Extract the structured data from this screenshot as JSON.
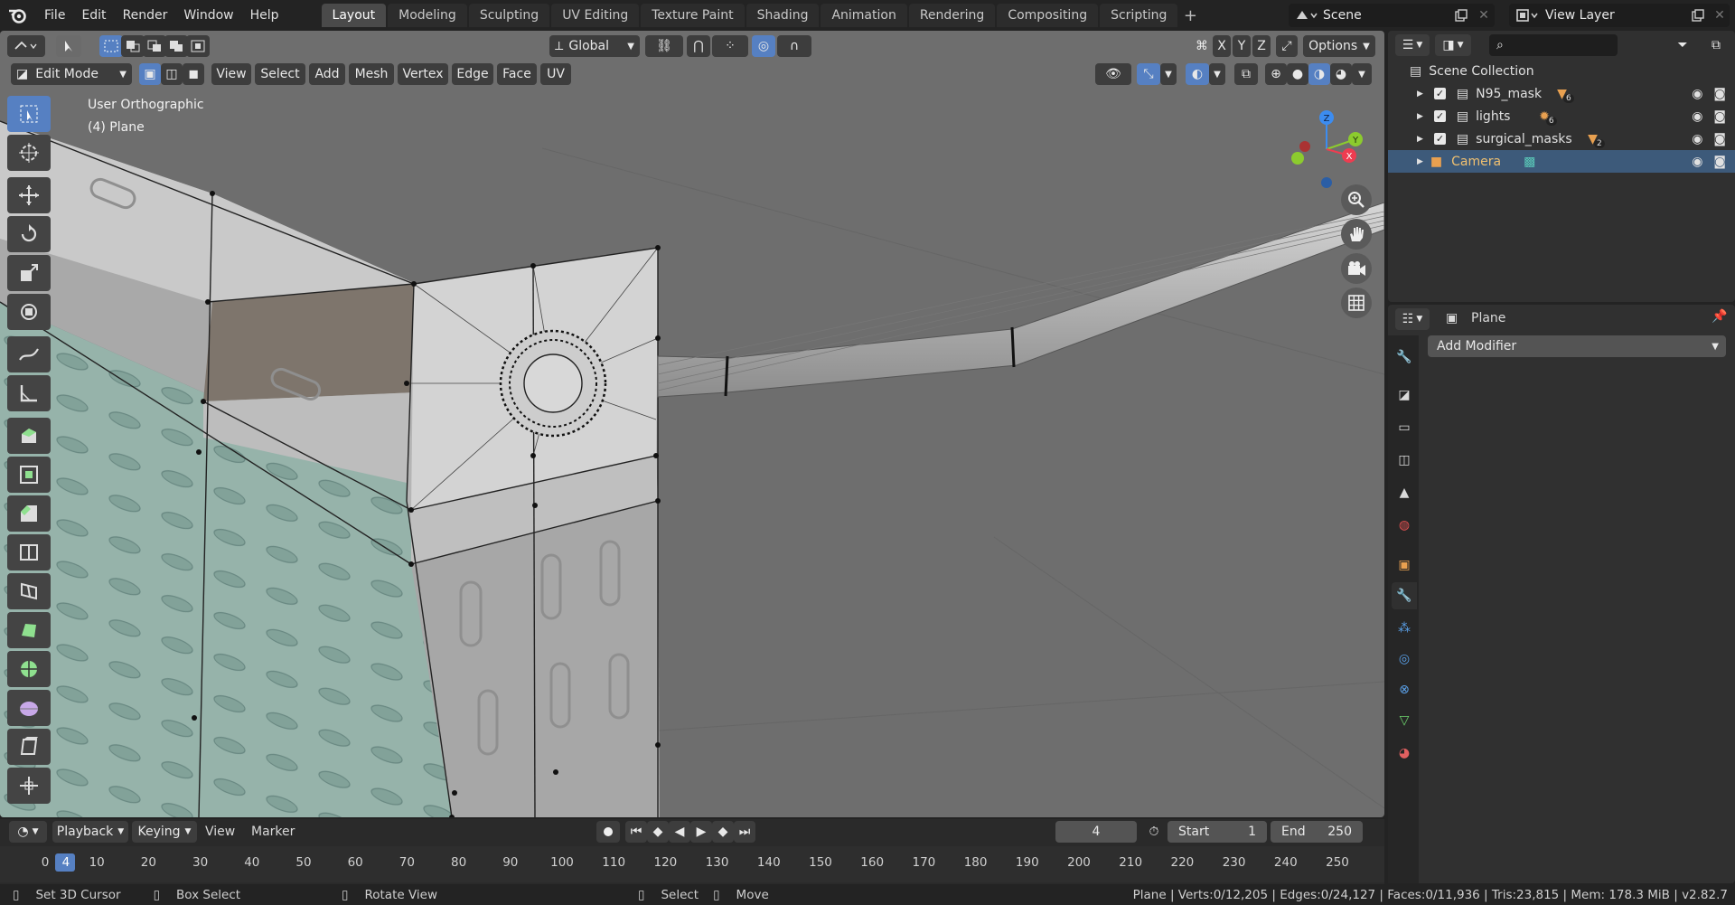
{
  "menu": [
    "File",
    "Edit",
    "Render",
    "Window",
    "Help"
  ],
  "workspaces": [
    {
      "label": "Layout",
      "active": true
    },
    {
      "label": "Modeling",
      "active": false
    },
    {
      "label": "Sculpting",
      "active": false
    },
    {
      "label": "UV Editing",
      "active": false
    },
    {
      "label": "Texture Paint",
      "active": false
    },
    {
      "label": "Shading",
      "active": false
    },
    {
      "label": "Animation",
      "active": false
    },
    {
      "label": "Rendering",
      "active": false
    },
    {
      "label": "Compositing",
      "active": false
    },
    {
      "label": "Scripting",
      "active": false
    }
  ],
  "scene": {
    "name": "Scene"
  },
  "view_layer": {
    "name": "View Layer"
  },
  "viewport_header": {
    "transform_orientation": "Global",
    "axes": [
      "X",
      "Y",
      "Z"
    ],
    "options_label": "Options",
    "mode": "Edit Mode",
    "menus": [
      "View",
      "Select",
      "Add",
      "Mesh",
      "Vertex",
      "Edge",
      "Face",
      "UV"
    ]
  },
  "viewport_overlay": {
    "view_name": "User Orthographic",
    "object_info": "(4) Plane"
  },
  "gizmo": {
    "x": "X",
    "y": "Y",
    "z": "Z"
  },
  "outliner": {
    "root": "Scene Collection",
    "items": [
      {
        "label": "N95_mask",
        "badge": "6",
        "selected": false
      },
      {
        "label": "lights",
        "badge": "6",
        "selected": false
      },
      {
        "label": "surgical_masks",
        "badge": "2",
        "selected": false
      },
      {
        "label": "Camera",
        "badge": "",
        "selected": true
      }
    ]
  },
  "properties": {
    "object_name": "Plane",
    "add_modifier_label": "Add Modifier"
  },
  "timeline": {
    "menus": [
      "Playback",
      "Keying",
      "View",
      "Marker"
    ],
    "current_frame": "4",
    "start_label": "Start",
    "start_value": "1",
    "end_label": "End",
    "end_value": "250",
    "ticks": [
      "0",
      "4",
      "10",
      "20",
      "30",
      "40",
      "50",
      "60",
      "70",
      "80",
      "90",
      "100",
      "110",
      "120",
      "130",
      "140",
      "150",
      "160",
      "170",
      "180",
      "190",
      "200",
      "210",
      "220",
      "230",
      "240",
      "250"
    ]
  },
  "statusbar": {
    "hint1": "Set 3D Cursor",
    "hint2": "Box Select",
    "hint3": "Rotate View",
    "hint4": "Select",
    "hint5": "Move",
    "stats": "Plane | Verts:0/12,205 | Edges:0/24,127 | Faces:0/11,936 | Tris:23,815 | Mem: 178.3 MiB | v2.82.7"
  },
  "colors": {
    "accent": "#5680c2",
    "selected_row": "#3d5a7a",
    "viewport_bg": "#6e6e6e"
  }
}
